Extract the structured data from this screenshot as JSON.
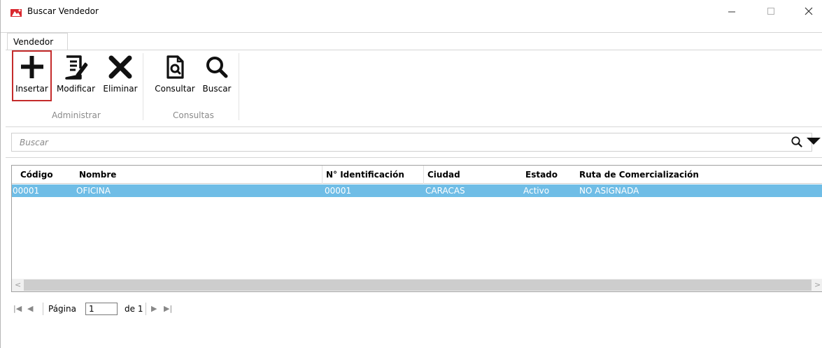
{
  "window": {
    "title": "Buscar Vendedor",
    "minimize_glyph": "—",
    "maximize_glyph": "☐",
    "close_glyph": "✕"
  },
  "ribbon": {
    "tab_label": "Vendedor",
    "buttons": [
      {
        "label": "Insertar",
        "icon": "plus-icon",
        "highlighted": true
      },
      {
        "label": "Modificar",
        "icon": "edit-document-icon"
      },
      {
        "label": "Eliminar",
        "icon": "delete-x-icon"
      },
      {
        "label": "Consultar",
        "icon": "document-search-icon"
      },
      {
        "label": "Buscar",
        "icon": "search-icon"
      }
    ],
    "groups": [
      "Administrar",
      "Consultas"
    ]
  },
  "search": {
    "placeholder": "Buscar",
    "value": ""
  },
  "grid": {
    "columns": [
      "Código",
      "Nombre",
      "N° Identificación",
      "Ciudad",
      "Estado",
      "Ruta de Comercialización"
    ],
    "rows": [
      {
        "codigo": "00001",
        "nombre": "OFICINA",
        "identificacion": "00001",
        "ciudad": "CARACAS",
        "estado": "Activo",
        "ruta": "NO ASIGNADA",
        "selected": true
      }
    ]
  },
  "pager": {
    "page_label": "Página",
    "current_page": "1",
    "of_label": "de 1"
  },
  "colors": {
    "selection": "#6fbde6",
    "highlight_border": "#c42b2b"
  }
}
